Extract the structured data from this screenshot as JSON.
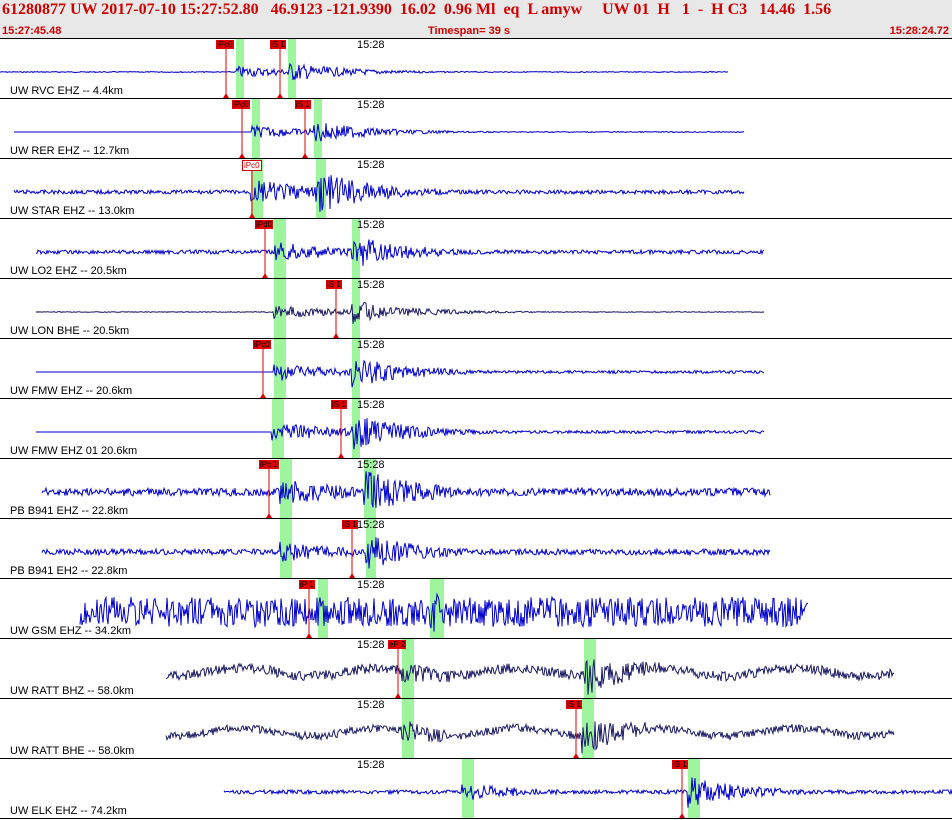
{
  "header": {
    "event_line": "61280877 UW 2017-07-10 15:27:52.80   46.9123 -121.9390  16.02  0.96 Ml  eq  L amyw     UW 01  H   1  -  H C3   14.46  1.56",
    "start_time": "15:27:45.48",
    "timespan": "Timespan=  39 s",
    "end_time": "15:28:24.72"
  },
  "time_tick": "15:28",
  "colors": {
    "header_text": "#d00000",
    "trace": "#0000cc",
    "trace_dark": "#1a1a66",
    "pick": "#e00000",
    "window": "#9ef59e"
  },
  "channels": [
    {
      "label": "UW RVC EHZ -- 4.4km",
      "color": "#0000cc",
      "picks": [
        {
          "text": "iPc0",
          "filled": true
        },
        {
          "text": "iS 1",
          "filled": true
        }
      ]
    },
    {
      "label": "UW RER EHZ -- 12.7km",
      "color": "#0000cc",
      "picks": [
        {
          "text": "iPc0",
          "filled": true
        },
        {
          "text": "iS 1",
          "filled": true
        }
      ]
    },
    {
      "label": "UW STAR EHZ -- 13.0km",
      "color": "#0000cc",
      "picks": [
        {
          "text": "iPc0",
          "filled": false
        }
      ]
    },
    {
      "label": "UW LO2 EHZ -- 20.5km",
      "color": "#0000cc",
      "picks": [
        {
          "text": "iPd0",
          "filled": true
        }
      ]
    },
    {
      "label": "UW LON BHE -- 20.5km",
      "color": "#1a1a66",
      "picks": [
        {
          "text": "iS 1",
          "filled": true
        }
      ]
    },
    {
      "label": "UW FMW EHZ -- 20.6km",
      "color": "#0000cc",
      "picks": [
        {
          "text": "iPc0",
          "filled": true
        }
      ]
    },
    {
      "label": "UW FMW EHZ 01 20.6km",
      "color": "#0000cc",
      "picks": [
        {
          "text": "iS 1",
          "filled": true
        }
      ]
    },
    {
      "label": "PB B941 EHZ -- 22.8km",
      "color": "#0000cc",
      "picks": [
        {
          "text": "iPc 1",
          "filled": true
        }
      ]
    },
    {
      "label": "PB B941 EH2 -- 22.8km",
      "color": "#0000cc",
      "picks": [
        {
          "text": "iS 1",
          "filled": true
        }
      ]
    },
    {
      "label": "UW GSM EHZ -- 34.2km",
      "color": "#0000cc",
      "picks": [
        {
          "text": "iP 1",
          "filled": true
        }
      ]
    },
    {
      "label": "UW RATT BHZ -- 58.0km",
      "color": "#1a1a66",
      "picks": [
        {
          "text": "eP 2",
          "filled": true
        }
      ]
    },
    {
      "label": "UW RATT BHE -- 58.0km",
      "color": "#1a1a66",
      "picks": [
        {
          "text": "iS 1",
          "filled": true
        }
      ]
    },
    {
      "label": "UW ELK EHZ -- 74.2km",
      "color": "#0000cc",
      "picks": [
        {
          "text": "iS 1",
          "filled": true
        }
      ]
    }
  ]
}
